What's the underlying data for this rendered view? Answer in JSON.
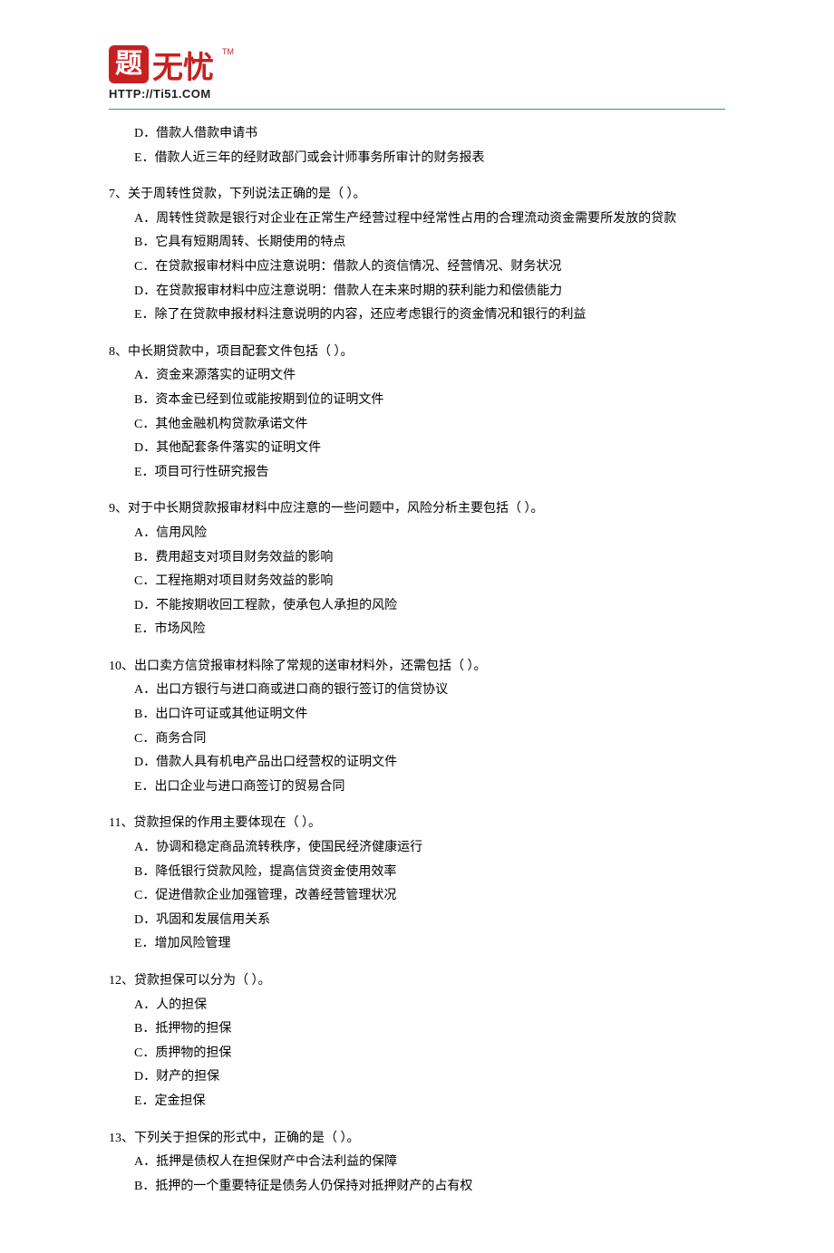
{
  "logo": {
    "brand_text_main": "题无忧",
    "tm": "TM",
    "url": "HTTP://Ti51.COM"
  },
  "continued": {
    "options": [
      "D．借款人借款申请书",
      "E．借款人近三年的经财政部门或会计师事务所审计的财务报表"
    ]
  },
  "questions": [
    {
      "stem": "7、关于周转性贷款，下列说法正确的是（ ）。",
      "options": [
        "A．周转性贷款是银行对企业在正常生产经营过程中经常性占用的合理流动资金需要所发放的贷款",
        "B．它具有短期周转、长期使用的特点",
        "C．在贷款报审材料中应注意说明：借款人的资信情况、经营情况、财务状况",
        "D．在贷款报审材料中应注意说明：借款人在未来时期的获利能力和偿债能力",
        "E．除了在贷款申报材料注意说明的内容，还应考虑银行的资金情况和银行的利益"
      ]
    },
    {
      "stem": "8、中长期贷款中，项目配套文件包括（ ）。",
      "options": [
        "A．资金来源落实的证明文件",
        "B．资本金已经到位或能按期到位的证明文件",
        "C．其他金融机构贷款承诺文件",
        "D．其他配套条件落实的证明文件",
        "E．项目可行性研究报告"
      ]
    },
    {
      "stem": "9、对于中长期贷款报审材料中应注意的一些问题中，风险分析主要包括（ ）。",
      "options": [
        "A．信用风险",
        "B．费用超支对项目财务效益的影响",
        "C．工程拖期对项目财务效益的影响",
        "D．不能按期收回工程款，使承包人承担的风险",
        "E．市场风险"
      ]
    },
    {
      "stem": "10、出口卖方信贷报审材料除了常规的送审材料外，还需包括（ ）。",
      "options": [
        "A．出口方银行与进口商或进口商的银行签订的信贷协议",
        "B．出口许可证或其他证明文件",
        "C．商务合同",
        "D．借款人具有机电产品出口经营权的证明文件",
        "E．出口企业与进口商签订的贸易合同"
      ]
    },
    {
      "stem": "11、贷款担保的作用主要体现在（ ）。",
      "options": [
        "A．协调和稳定商品流转秩序，使国民经济健康运行",
        "B．降低银行贷款风险，提高信贷资金使用效率",
        "C．促进借款企业加强管理，改善经营管理状况",
        "D．巩固和发展信用关系",
        "E．增加风险管理"
      ]
    },
    {
      "stem": "12、贷款担保可以分为（ ）。",
      "options": [
        "A．人的担保",
        "B．抵押物的担保",
        "C．质押物的担保",
        "D．财产的担保",
        "E．定金担保"
      ]
    },
    {
      "stem": "13、下列关于担保的形式中，正确的是（ ）。",
      "options": [
        "A．抵押是债权人在担保财产中合法利益的保障",
        "B．抵押的一个重要特征是债务人仍保持对抵押财产的占有权"
      ]
    }
  ]
}
